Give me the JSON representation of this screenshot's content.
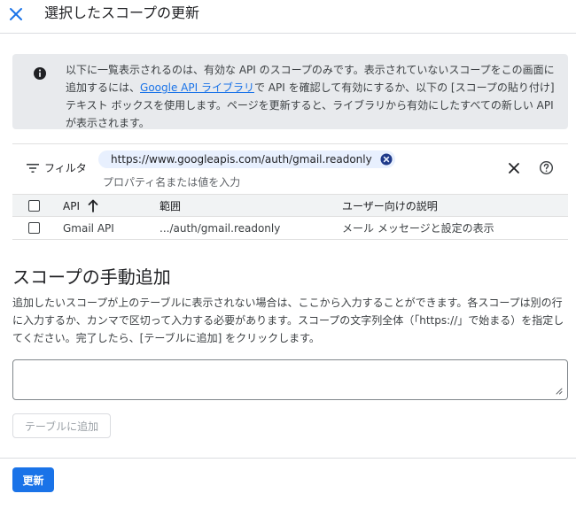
{
  "header": {
    "title": "選択したスコープの更新",
    "close_icon": "close-icon"
  },
  "info": {
    "icon": "info-icon",
    "text_before": "以下に一覧表示されるのは、有効な API のスコープのみです。表示されていないスコープをこの画面に追加するには、",
    "link_text": "Google API ライブラリ",
    "text_after": "で API を確認して有効にするか、以下の [スコープの貼り付け] テキスト ボックスを使用します。ページを更新すると、ライブラリから有効にしたすべての新しい API が表示されます。"
  },
  "filter": {
    "label": "フィルタ",
    "chip_text": "https://www.googleapis.com/auth/gmail.readonly",
    "placeholder": "プロパティ名または値を入力",
    "clear_icon": "close-icon",
    "help_icon": "help-icon"
  },
  "table": {
    "columns": [
      "API",
      "範囲",
      "ユーザー向けの説明"
    ],
    "rows": [
      {
        "api": "Gmail API",
        "scope": ".../auth/gmail.readonly",
        "description": "メール メッセージと設定の表示"
      }
    ]
  },
  "manual": {
    "title": "スコープの手動追加",
    "description": "追加したいスコープが上のテーブルに表示されない場合は、ここから入力することができます。各スコープは別の行に入力するか、カンマで区切って入力する必要があります。スコープの文字列全体（「https://」で始まる）を指定してください。完了したら、[テーブルに追加] をクリックします。",
    "textarea_value": "",
    "add_button": "テーブルに追加"
  },
  "footer": {
    "update_button": "更新"
  },
  "colors": {
    "accent": "#1a73e8",
    "info_bg": "#e8eaed",
    "chip_bg": "#e8f0fe",
    "chip_icon": "#1f3a8a"
  }
}
